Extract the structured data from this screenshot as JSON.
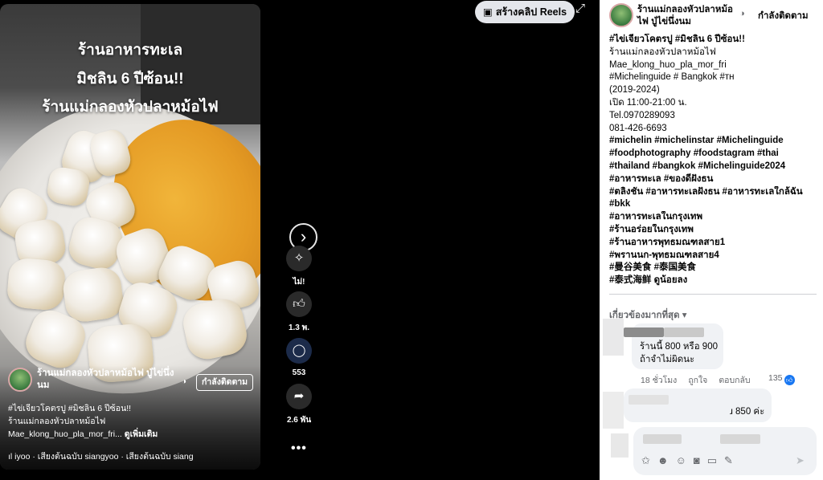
{
  "video": {
    "overlay_lines": [
      "ร้านอาหารทะเล",
      "มิชลิน 6 ปีซ้อน!!",
      "ร้านแม่กลองหัวปลาหม้อไฟ"
    ],
    "page_name": "ร้านแม่กลองหัวปลาหม้อไฟ ปู่ไข่นึ่งนม",
    "globe_icon": "globe-icon",
    "follow_label": "กำลังติดตาม",
    "caption_line1": "#ไข่เจียวโคตรปู #มิชลิน 6 ปีซ้อน!!",
    "caption_line2": "ร้านแม่กลองหัวปลาหม้อไฟ",
    "caption_line3": "Mae_klong_huo_pla_mor_fri...",
    "see_more": "ดูเพิ่มเติม",
    "audio": "ıl  iyoo · เสียงต้นฉบับ      siangyoo · เสียงต้นฉบับ      siang"
  },
  "actions": {
    "next_icon": "chevron-right-icon",
    "items": [
      {
        "icon": "sparkle-icon",
        "label": "ไม่!"
      },
      {
        "icon": "thumbs-up-icon",
        "label": "1.3 พ."
      },
      {
        "icon": "comment-icon",
        "label": "553"
      },
      {
        "icon": "share-icon",
        "label": "2.6 พัน"
      }
    ],
    "more": "•••"
  },
  "header": {
    "create_reels": "สร้างคลิป Reels",
    "expand_icon": "expand-icon"
  },
  "post": {
    "page_name": "ร้านแม่กลองหัวปลาหม้อไฟ ปู่ไข่นึ่งนม",
    "follow_label": "กำลังติดตาม",
    "lines": [
      "#ไข่เจียวโคตรปู #มิชลิน 6 ปีซ้อน!!",
      "ร้านแม่กลองหัวปลาหม้อไฟ",
      "Mae_klong_huo_pla_mor_fri",
      "#Michelinguide # Bangkok #ᴛʜ",
      "(2019-2024)",
      "เปิด 11:00-21:00 น.",
      "Tel.0970289093",
      "  081-426-6693",
      "#michelin #michelinstar #Michelinguide",
      "#foodphotography #foodstagram  #thai",
      "#thailand #bangkok #Michelinguide2024",
      "#อาหารทะเล #ของดีฝั่งธน",
      " #ตลิ่งชัน #อาหารทะเลฝั่งธน #อาหารทะเลใกล้ฉัน",
      "#bkk",
      "#อาหารทะเลในกรุงเทพ",
      "#ร้านอร่อยในกรุงเทพ",
      "#ร้านอาหารพุทธมณฑลสาย1",
      "#พรานนก-พุทธมณฑลสาย4",
      "#曼谷美食  #泰国美食",
      "#泰式海鲜 ดูน้อยลง"
    ]
  },
  "comments": {
    "sort_label": "เกี่ยวข้องมากที่สุด",
    "sort_icon": "caret-down-icon",
    "first": {
      "line1": "ร้านนี้ 800 หรือ 900",
      "line2": "ถ้าจำไม่ผิดนะ",
      "time": "18 ชั่วโมง",
      "like": "ถูกใจ",
      "reply": "ตอบกลับ",
      "reactions": "135"
    },
    "second": {
      "fragment": "ɹ 850 ค่ะ"
    },
    "composer_icons": [
      "sticker-icon",
      "avatar-sticker-icon",
      "emoji-icon",
      "camera-icon",
      "gif-icon",
      "sticker-sheet-icon"
    ],
    "send_icon": "send-icon"
  }
}
